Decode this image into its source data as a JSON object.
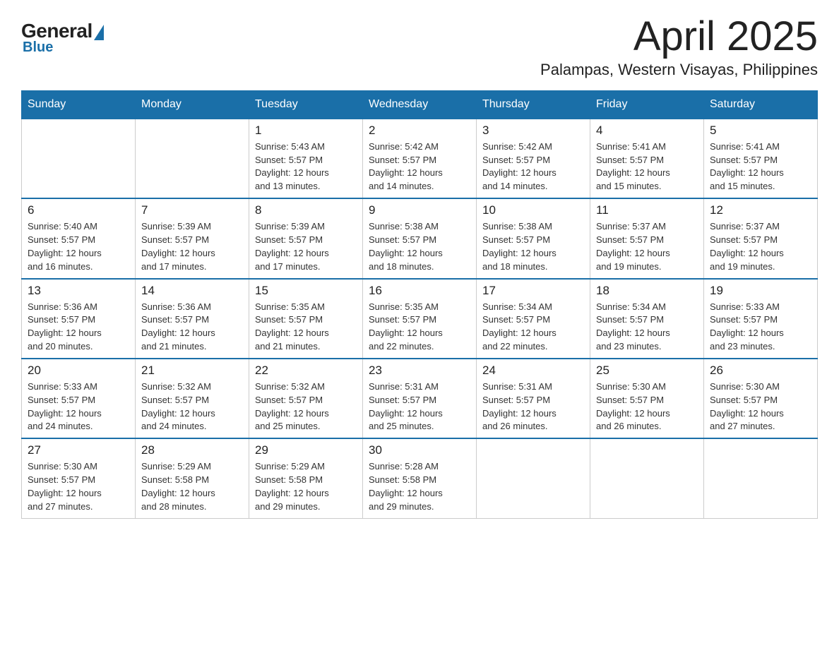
{
  "logo": {
    "general": "General",
    "blue": "Blue",
    "triangle": true
  },
  "title": "April 2025",
  "subtitle": "Palampas, Western Visayas, Philippines",
  "days_header": [
    "Sunday",
    "Monday",
    "Tuesday",
    "Wednesday",
    "Thursday",
    "Friday",
    "Saturday"
  ],
  "weeks": [
    [
      {
        "day": "",
        "info": ""
      },
      {
        "day": "",
        "info": ""
      },
      {
        "day": "1",
        "info": "Sunrise: 5:43 AM\nSunset: 5:57 PM\nDaylight: 12 hours\nand 13 minutes."
      },
      {
        "day": "2",
        "info": "Sunrise: 5:42 AM\nSunset: 5:57 PM\nDaylight: 12 hours\nand 14 minutes."
      },
      {
        "day": "3",
        "info": "Sunrise: 5:42 AM\nSunset: 5:57 PM\nDaylight: 12 hours\nand 14 minutes."
      },
      {
        "day": "4",
        "info": "Sunrise: 5:41 AM\nSunset: 5:57 PM\nDaylight: 12 hours\nand 15 minutes."
      },
      {
        "day": "5",
        "info": "Sunrise: 5:41 AM\nSunset: 5:57 PM\nDaylight: 12 hours\nand 15 minutes."
      }
    ],
    [
      {
        "day": "6",
        "info": "Sunrise: 5:40 AM\nSunset: 5:57 PM\nDaylight: 12 hours\nand 16 minutes."
      },
      {
        "day": "7",
        "info": "Sunrise: 5:39 AM\nSunset: 5:57 PM\nDaylight: 12 hours\nand 17 minutes."
      },
      {
        "day": "8",
        "info": "Sunrise: 5:39 AM\nSunset: 5:57 PM\nDaylight: 12 hours\nand 17 minutes."
      },
      {
        "day": "9",
        "info": "Sunrise: 5:38 AM\nSunset: 5:57 PM\nDaylight: 12 hours\nand 18 minutes."
      },
      {
        "day": "10",
        "info": "Sunrise: 5:38 AM\nSunset: 5:57 PM\nDaylight: 12 hours\nand 18 minutes."
      },
      {
        "day": "11",
        "info": "Sunrise: 5:37 AM\nSunset: 5:57 PM\nDaylight: 12 hours\nand 19 minutes."
      },
      {
        "day": "12",
        "info": "Sunrise: 5:37 AM\nSunset: 5:57 PM\nDaylight: 12 hours\nand 19 minutes."
      }
    ],
    [
      {
        "day": "13",
        "info": "Sunrise: 5:36 AM\nSunset: 5:57 PM\nDaylight: 12 hours\nand 20 minutes."
      },
      {
        "day": "14",
        "info": "Sunrise: 5:36 AM\nSunset: 5:57 PM\nDaylight: 12 hours\nand 21 minutes."
      },
      {
        "day": "15",
        "info": "Sunrise: 5:35 AM\nSunset: 5:57 PM\nDaylight: 12 hours\nand 21 minutes."
      },
      {
        "day": "16",
        "info": "Sunrise: 5:35 AM\nSunset: 5:57 PM\nDaylight: 12 hours\nand 22 minutes."
      },
      {
        "day": "17",
        "info": "Sunrise: 5:34 AM\nSunset: 5:57 PM\nDaylight: 12 hours\nand 22 minutes."
      },
      {
        "day": "18",
        "info": "Sunrise: 5:34 AM\nSunset: 5:57 PM\nDaylight: 12 hours\nand 23 minutes."
      },
      {
        "day": "19",
        "info": "Sunrise: 5:33 AM\nSunset: 5:57 PM\nDaylight: 12 hours\nand 23 minutes."
      }
    ],
    [
      {
        "day": "20",
        "info": "Sunrise: 5:33 AM\nSunset: 5:57 PM\nDaylight: 12 hours\nand 24 minutes."
      },
      {
        "day": "21",
        "info": "Sunrise: 5:32 AM\nSunset: 5:57 PM\nDaylight: 12 hours\nand 24 minutes."
      },
      {
        "day": "22",
        "info": "Sunrise: 5:32 AM\nSunset: 5:57 PM\nDaylight: 12 hours\nand 25 minutes."
      },
      {
        "day": "23",
        "info": "Sunrise: 5:31 AM\nSunset: 5:57 PM\nDaylight: 12 hours\nand 25 minutes."
      },
      {
        "day": "24",
        "info": "Sunrise: 5:31 AM\nSunset: 5:57 PM\nDaylight: 12 hours\nand 26 minutes."
      },
      {
        "day": "25",
        "info": "Sunrise: 5:30 AM\nSunset: 5:57 PM\nDaylight: 12 hours\nand 26 minutes."
      },
      {
        "day": "26",
        "info": "Sunrise: 5:30 AM\nSunset: 5:57 PM\nDaylight: 12 hours\nand 27 minutes."
      }
    ],
    [
      {
        "day": "27",
        "info": "Sunrise: 5:30 AM\nSunset: 5:57 PM\nDaylight: 12 hours\nand 27 minutes."
      },
      {
        "day": "28",
        "info": "Sunrise: 5:29 AM\nSunset: 5:58 PM\nDaylight: 12 hours\nand 28 minutes."
      },
      {
        "day": "29",
        "info": "Sunrise: 5:29 AM\nSunset: 5:58 PM\nDaylight: 12 hours\nand 29 minutes."
      },
      {
        "day": "30",
        "info": "Sunrise: 5:28 AM\nSunset: 5:58 PM\nDaylight: 12 hours\nand 29 minutes."
      },
      {
        "day": "",
        "info": ""
      },
      {
        "day": "",
        "info": ""
      },
      {
        "day": "",
        "info": ""
      }
    ]
  ]
}
